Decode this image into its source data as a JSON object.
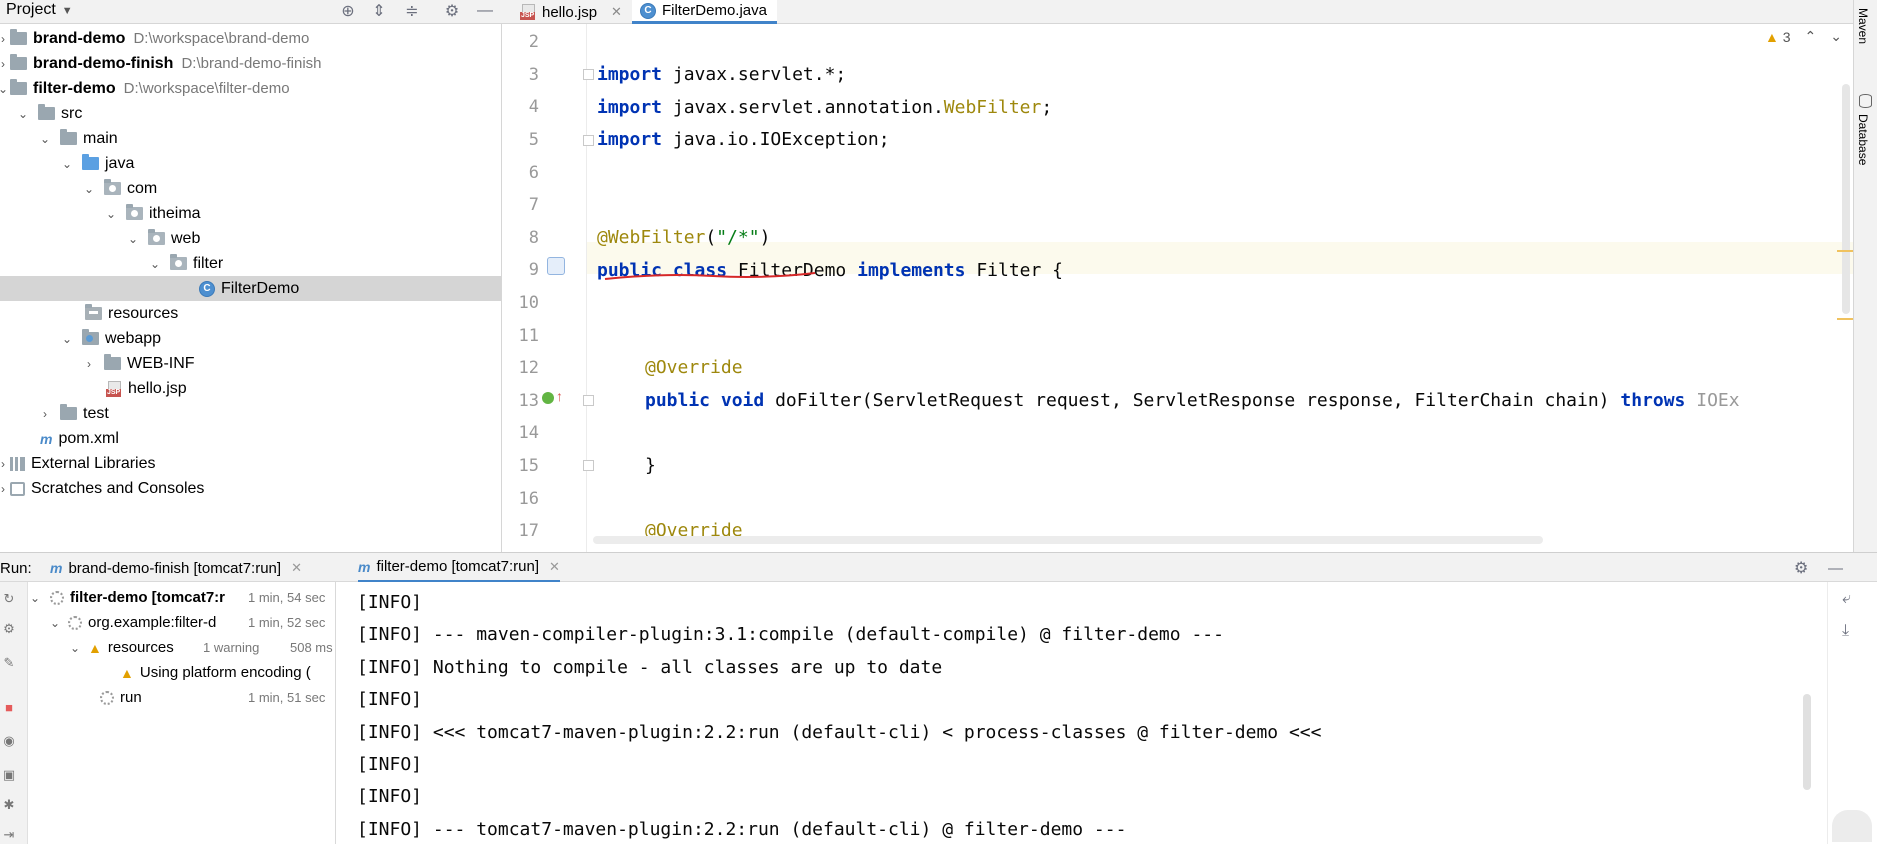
{
  "header": {
    "project_label": "Project",
    "tabs": [
      {
        "label": "hello.jsp",
        "icon": "jsp-file-icon",
        "active": false
      },
      {
        "label": "FilterDemo.java",
        "icon": "java-class-icon",
        "active": true
      }
    ]
  },
  "tree": {
    "items": [
      {
        "label": "brand-demo",
        "path": "D:\\workspace\\brand-demo",
        "bold": true
      },
      {
        "label": "brand-demo-finish",
        "path": "D:\\brand-demo-finish",
        "bold": true
      },
      {
        "label": "filter-demo",
        "path": "D:\\workspace\\filter-demo",
        "bold": true
      },
      {
        "label": "src"
      },
      {
        "label": "main"
      },
      {
        "label": "java"
      },
      {
        "label": "com"
      },
      {
        "label": "itheima"
      },
      {
        "label": "web"
      },
      {
        "label": "filter"
      },
      {
        "label": "FilterDemo"
      },
      {
        "label": "resources"
      },
      {
        "label": "webapp"
      },
      {
        "label": "WEB-INF"
      },
      {
        "label": "hello.jsp"
      },
      {
        "label": "test"
      },
      {
        "label": "pom.xml"
      },
      {
        "label": "External Libraries"
      },
      {
        "label": "Scratches and Consoles"
      }
    ]
  },
  "editor": {
    "warning_count": "3",
    "line_numbers": [
      "2",
      "3",
      "4",
      "5",
      "6",
      "7",
      "8",
      "9",
      "10",
      "11",
      "12",
      "13",
      "14",
      "15",
      "16",
      "17"
    ],
    "lines": {
      "l3_kw": "import",
      "l3_rest": " javax.servlet.*;",
      "l4_kw": "import",
      "l4_rest": " javax.servlet.annotation.",
      "l4_ann": "WebFilter",
      "l4_end": ";",
      "l5_kw": "import",
      "l5_rest": " java.io.IOException;",
      "l8_ann": "@WebFilter",
      "l8_open": "(",
      "l8_str": "\"/*\"",
      "l8_close": ")",
      "l9_kw1": "public",
      "l9_kw2": "class",
      "l9_name": " FilterDemo ",
      "l9_kw3": "implements",
      "l9_rest": " Filter {",
      "l12_ann": "@Override",
      "l13_kw1": "public",
      "l13_kw2": "void",
      "l13_rest": " doFilter(ServletRequest request, ServletResponse response, FilterChain chain) ",
      "l13_kw3": "throws",
      "l13_tail": " IOEx",
      "l15": "}",
      "l17_ann": "@Override"
    }
  },
  "right_strip": {
    "maven": "Maven",
    "database": "Database"
  },
  "run": {
    "label": "Run:",
    "tabs": [
      {
        "label": "brand-demo-finish [tomcat7:run]",
        "active": false
      },
      {
        "label": "filter-demo [tomcat7:run]",
        "active": true
      }
    ],
    "tree": [
      {
        "label": "filter-demo [tomcat7:r",
        "time": "1 min, 54 sec"
      },
      {
        "label": "org.example:filter-d",
        "time": "1 min, 52 sec"
      },
      {
        "label": "resources",
        "sub": "1 warning",
        "time": "508 ms"
      },
      {
        "label": "Using platform encoding ("
      },
      {
        "label": "run",
        "time": "1 min, 51 sec"
      }
    ],
    "console": [
      "[INFO]",
      "[INFO] --- maven-compiler-plugin:3.1:compile (default-compile) @ filter-demo ---",
      "[INFO] Nothing to compile - all classes are up to date",
      "[INFO]",
      "[INFO] <<< tomcat7-maven-plugin:2.2:run (default-cli) < process-classes @ filter-demo <<<",
      "[INFO]",
      "[INFO]",
      "[INFO] --- tomcat7-maven-plugin:2.2:run (default-cli) @ filter-demo ---"
    ]
  }
}
